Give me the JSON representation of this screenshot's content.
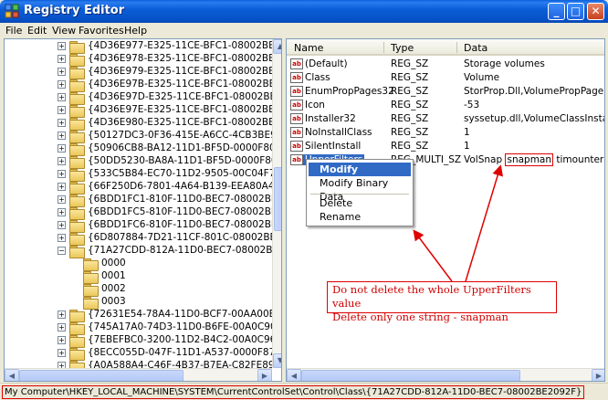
{
  "window": {
    "title": "Registry Editor",
    "minimize_glyph": "_",
    "maximize_glyph": "□",
    "close_glyph": "✕"
  },
  "menu": [
    "File",
    "Edit",
    "View",
    "Favorites",
    "Help"
  ],
  "tree": {
    "rows": [
      {
        "label": "{4D36E977-E325-11CE-BFC1-08002BE10318}",
        "expander": "+"
      },
      {
        "label": "{4D36E978-E325-11CE-BFC1-08002BE10318}",
        "expander": "+"
      },
      {
        "label": "{4D36E979-E325-11CE-BFC1-08002BE10318}",
        "expander": "+"
      },
      {
        "label": "{4D36E97B-E325-11CE-BFC1-08002BE10318}",
        "expander": "+"
      },
      {
        "label": "{4D36E97D-E325-11CE-BFC1-08002BE10318}",
        "expander": "+"
      },
      {
        "label": "{4D36E97E-E325-11CE-BFC1-08002BE10318}",
        "expander": "+"
      },
      {
        "label": "{4D36E980-E325-11CE-BFC1-08002BE10318}",
        "expander": "+"
      },
      {
        "label": "{50127DC3-0F36-415E-A6CC-4CB3BE910B65}",
        "expander": "+"
      },
      {
        "label": "{50906CB8-BA12-11D1-BF5D-0000F805F530}",
        "expander": "+"
      },
      {
        "label": "{50DD5230-BA8A-11D1-BF5D-0000F805F530}",
        "expander": "+"
      },
      {
        "label": "{533C5B84-EC70-11D2-9505-00C04F79DEAF}",
        "expander": "+"
      },
      {
        "label": "{66F250D6-7801-4A64-B139-EEA80A450B24}",
        "expander": "+"
      },
      {
        "label": "{6BDD1FC1-810F-11D0-BEC7-08002BE2092F}",
        "expander": "+"
      },
      {
        "label": "{6BDD1FC5-810F-11D0-BEC7-08002BE2092F}",
        "expander": "+"
      },
      {
        "label": "{6BDD1FC6-810F-11D0-BEC7-08002BE2092F}",
        "expander": "+"
      },
      {
        "label": "{6D807884-7D21-11CF-801C-08002BE10318}",
        "expander": "+"
      },
      {
        "label": "{71A27CDD-812A-11D0-BEC7-08002BE2092F}",
        "expander": "−",
        "open": true
      },
      {
        "label": "0000",
        "child": true
      },
      {
        "label": "0001",
        "child": true
      },
      {
        "label": "0002",
        "child": true
      },
      {
        "label": "0003",
        "child": true
      },
      {
        "label": "{72631E54-78A4-11D0-BCF7-00AA00B7B32A}",
        "expander": "+"
      },
      {
        "label": "{745A17A0-74D3-11D0-B6FE-00A0C90F57DA}",
        "expander": "+"
      },
      {
        "label": "{7EBEFBC0-3200-11D2-B4C2-00A0C9697D07}",
        "expander": "+"
      },
      {
        "label": "{8ECC055D-047F-11D1-A537-0000F8753ED1}",
        "expander": "+"
      },
      {
        "label": "{A0A588A4-C46F-4B37-B7EA-C82FE89870C6}",
        "expander": "+"
      }
    ]
  },
  "list": {
    "headers": {
      "name": "Name",
      "type": "Type",
      "data": "Data"
    },
    "rows": [
      {
        "name": "(Default)",
        "type": "REG_SZ",
        "data": "Storage volumes"
      },
      {
        "name": "Class",
        "type": "REG_SZ",
        "data": "Volume"
      },
      {
        "name": "EnumPropPages32",
        "type": "REG_SZ",
        "data": "StorProp.Dll,VolumePropPageProvider"
      },
      {
        "name": "Icon",
        "type": "REG_SZ",
        "data": "-53"
      },
      {
        "name": "Installer32",
        "type": "REG_SZ",
        "data": "syssetup.dll,VolumeClassInstaller"
      },
      {
        "name": "NoInstallClass",
        "type": "REG_SZ",
        "data": "1"
      },
      {
        "name": "SilentInstall",
        "type": "REG_SZ",
        "data": "1"
      },
      {
        "name": "UpperFilters",
        "type": "REG_MULTI_SZ",
        "data_parts": [
          "VolSnap ",
          "snapman",
          " timounter"
        ],
        "selected": true
      }
    ],
    "icon_text": "ab"
  },
  "context_menu": {
    "items": [
      "Modify",
      "Modify Binary Data",
      "Delete",
      "Rename"
    ]
  },
  "annotation": {
    "line1": "Do not delete the whole UpperFilters value",
    "line2": "Delete only one string -  snapman"
  },
  "statusbar": {
    "path": "My Computer\\HKEY_LOCAL_MACHINE\\SYSTEM\\CurrentControlSet\\Control\\Class\\{71A27CDD-812A-11D0-BEC7-08002BE2092F}"
  },
  "colors": {
    "accent": "#316ac5",
    "annotation_red": "#e00000",
    "titlebar_blue": "#0b5ed7"
  }
}
